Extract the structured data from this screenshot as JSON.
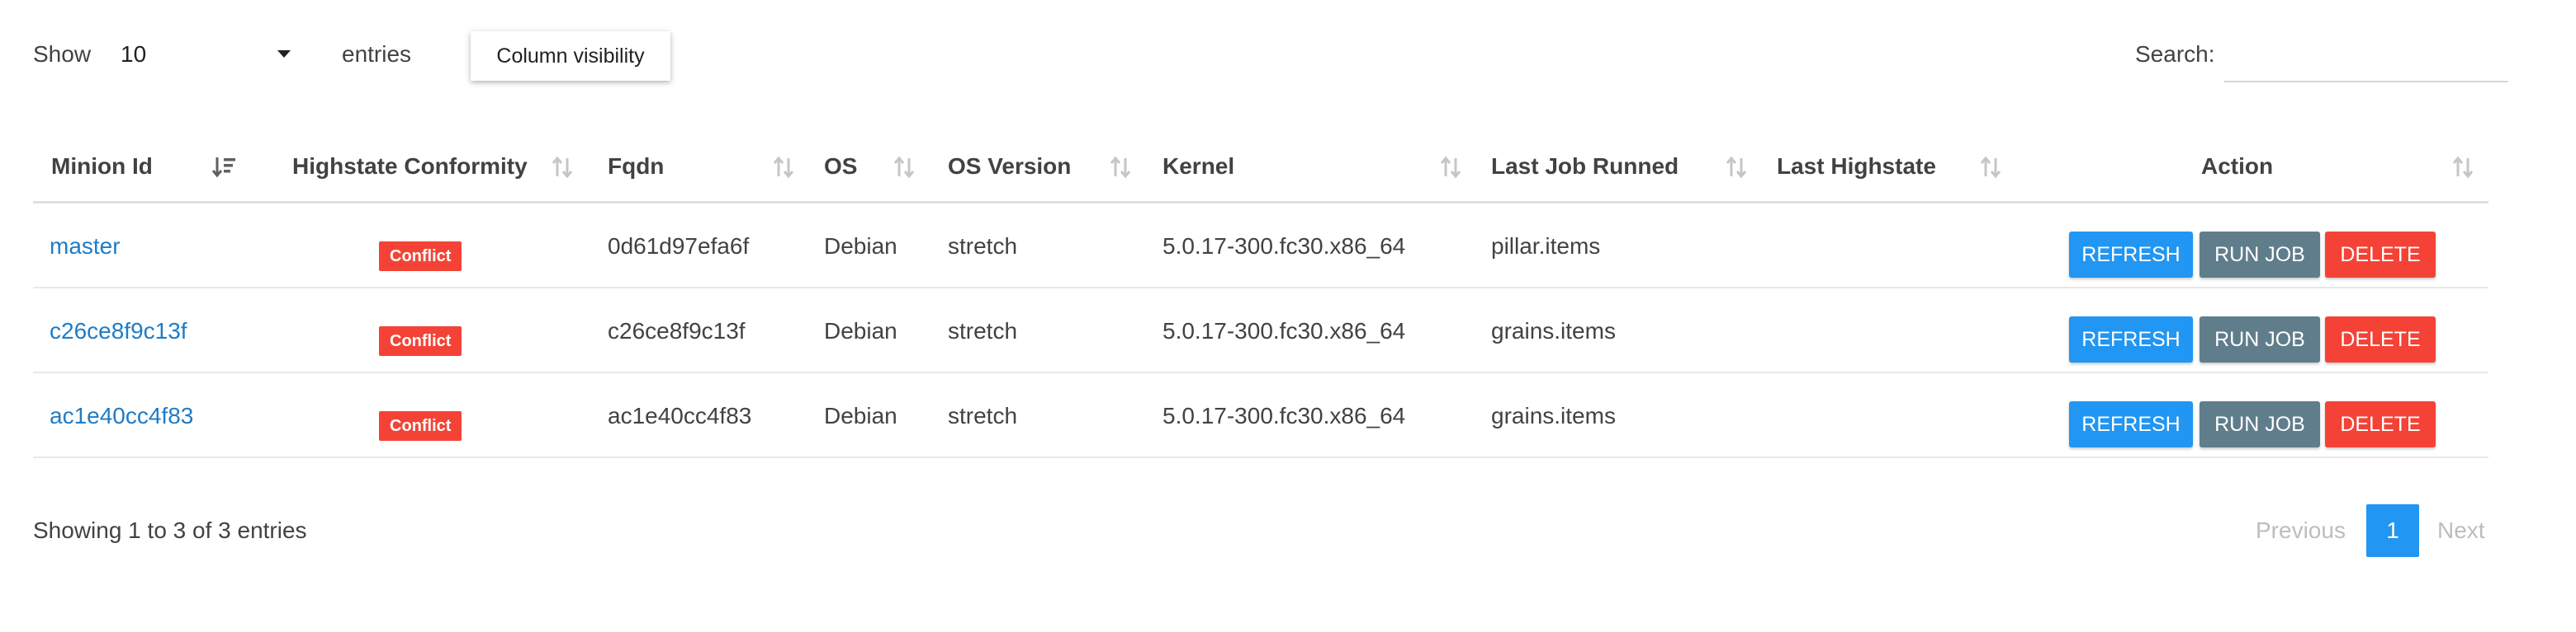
{
  "controls": {
    "show_label": "Show",
    "length_value": "10",
    "entries_label": "entries",
    "column_visibility_label": "Column visibility",
    "search_label": "Search:",
    "search_value": ""
  },
  "table": {
    "headers": [
      {
        "label": "Minion Id",
        "sort": "sorted-desc-icon"
      },
      {
        "label": "Highstate Conformity",
        "sort": "sort-both-icon"
      },
      {
        "label": "Fqdn",
        "sort": "sort-both-icon"
      },
      {
        "label": "OS",
        "sort": "sort-both-icon"
      },
      {
        "label": "OS Version",
        "sort": "sort-both-icon"
      },
      {
        "label": "Kernel",
        "sort": "sort-both-icon"
      },
      {
        "label": "Last Job Runned",
        "sort": "sort-both-icon"
      },
      {
        "label": "Last Highstate",
        "sort": "sort-both-icon"
      },
      {
        "label": "Action",
        "sort": "sort-both-icon"
      }
    ],
    "rows": [
      {
        "minion_id": "master",
        "conformity": "Conflict",
        "fqdn": "0d61d97efa6f",
        "os": "Debian",
        "os_version": "stretch",
        "kernel": "5.0.17-300.fc30.x86_64",
        "last_job": "pillar.items",
        "last_highstate": ""
      },
      {
        "minion_id": "c26ce8f9c13f",
        "conformity": "Conflict",
        "fqdn": "c26ce8f9c13f",
        "os": "Debian",
        "os_version": "stretch",
        "kernel": "5.0.17-300.fc30.x86_64",
        "last_job": "grains.items",
        "last_highstate": ""
      },
      {
        "minion_id": "ac1e40cc4f83",
        "conformity": "Conflict",
        "fqdn": "ac1e40cc4f83",
        "os": "Debian",
        "os_version": "stretch",
        "kernel": "5.0.17-300.fc30.x86_64",
        "last_job": "grains.items",
        "last_highstate": ""
      }
    ],
    "actions": {
      "refresh_label": "REFRESH",
      "run_job_label": "RUN JOB",
      "delete_label": "DELETE"
    }
  },
  "footer": {
    "info": "Showing 1 to 3 of 3 entries",
    "previous_label": "Previous",
    "current_page": "1",
    "next_label": "Next"
  },
  "colors": {
    "primary": "#2196f3",
    "run_job": "#607d8b",
    "danger": "#f44336",
    "link": "#1e7cc7"
  }
}
